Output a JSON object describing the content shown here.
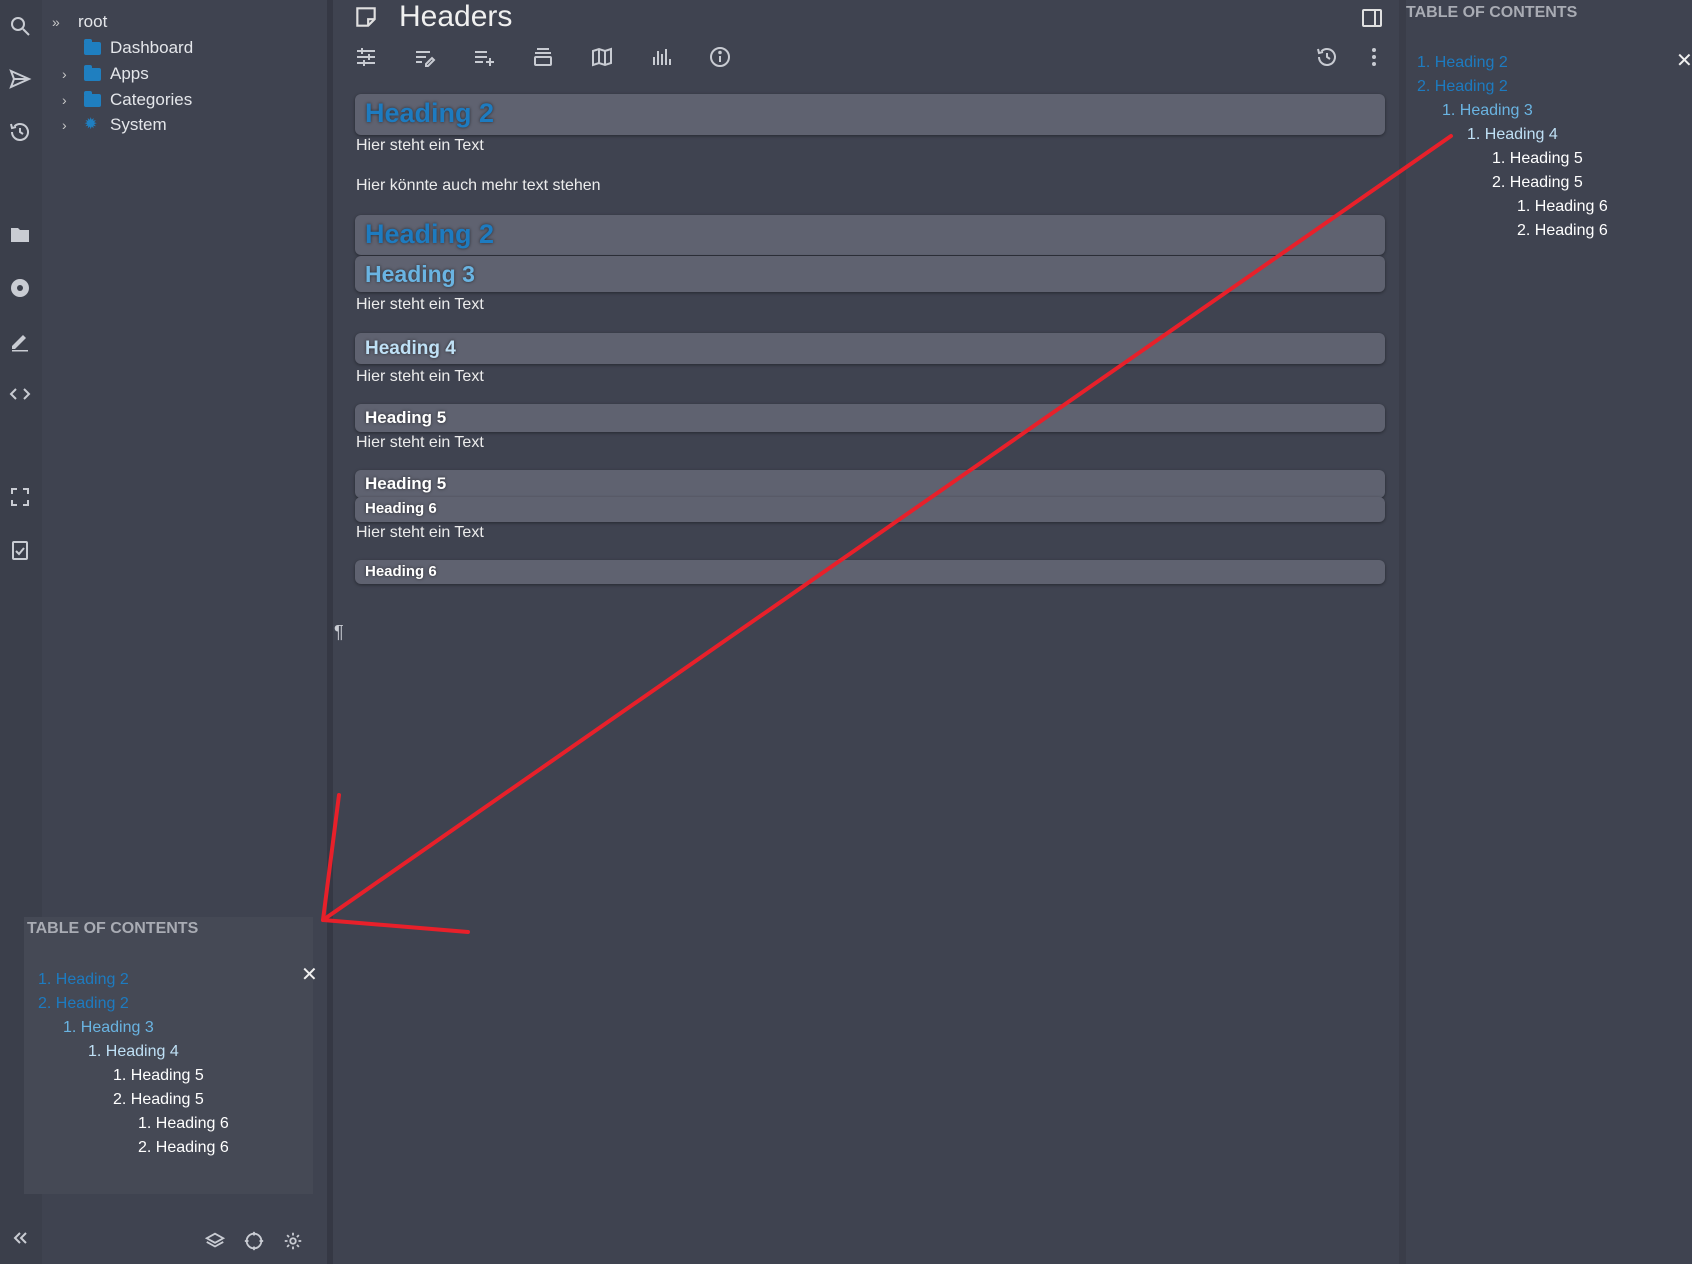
{
  "sidebar": {
    "tree": [
      {
        "label": "root",
        "kind": "root"
      },
      {
        "label": "Dashboard",
        "kind": "folder"
      },
      {
        "label": "Apps",
        "kind": "folder"
      },
      {
        "label": "Categories",
        "kind": "folder"
      },
      {
        "label": "System",
        "kind": "gear"
      }
    ]
  },
  "note": {
    "title": "Headers",
    "blocks": {
      "h2a": "Heading 2",
      "p1": "Hier steht ein Text",
      "p2": "Hier könnte auch mehr text stehen",
      "h2b": "Heading 2",
      "h3": "Heading 3",
      "p3": "Hier steht ein Text",
      "h4": "Heading 4",
      "p4": "Hier steht ein Text",
      "h5a": "Heading 5",
      "p5": "Hier steht ein Text",
      "h5b": "Heading 5",
      "h6a": "Heading 6",
      "p6": "Hier steht ein Text",
      "h6b": "Heading 6"
    },
    "pilcrow": "¶"
  },
  "toc": {
    "title": "TABLE OF CONTENTS",
    "close": "✕",
    "items": [
      {
        "num": "1.",
        "label": "Heading 2"
      },
      {
        "num": "2.",
        "label": "Heading 2"
      },
      {
        "num": "1.",
        "label": "Heading 3"
      },
      {
        "num": "1.",
        "label": "Heading 4"
      },
      {
        "num": "1.",
        "label": "Heading 5"
      },
      {
        "num": "2.",
        "label": "Heading 5"
      },
      {
        "num": "1.",
        "label": "Heading 6"
      },
      {
        "num": "2.",
        "label": "Heading 6"
      }
    ]
  },
  "colors": {
    "heading2": "#1d7bc0",
    "heading3": "#6ab4e2",
    "heading4": "#bfe0f5",
    "heading5": "#ffffff",
    "annotation": "#e8202a"
  }
}
